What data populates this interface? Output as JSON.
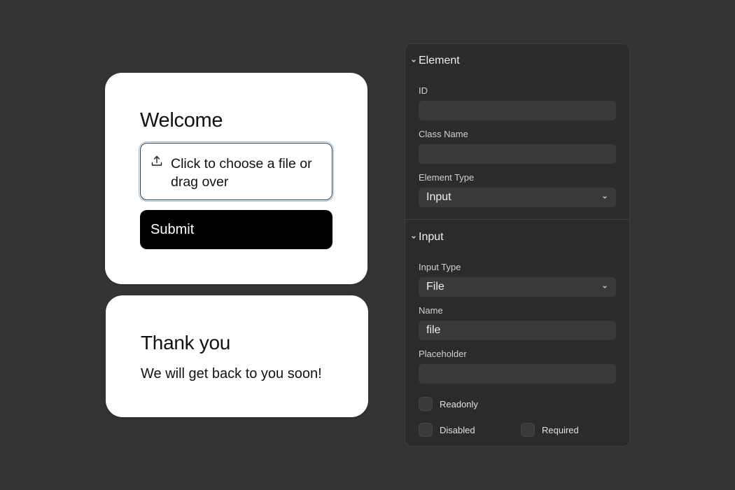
{
  "welcome_card": {
    "title": "Welcome",
    "file_input": {
      "placeholder": "Click to choose a file or drag over",
      "icon": "upload-icon"
    },
    "submit_label": "Submit"
  },
  "thanks_card": {
    "title": "Thank you",
    "message": "We will get back to you soon!"
  },
  "panel": {
    "element_section": {
      "title": "Element",
      "id_label": "ID",
      "id_value": "",
      "class_label": "Class Name",
      "class_value": "",
      "type_label": "Element Type",
      "type_value": "Input"
    },
    "input_section": {
      "title": "Input",
      "input_type_label": "Input Type",
      "input_type_value": "File",
      "name_label": "Name",
      "name_value": "file",
      "placeholder_label": "Placeholder",
      "placeholder_value": "",
      "readonly_label": "Readonly",
      "disabled_label": "Disabled",
      "required_label": "Required"
    }
  },
  "colors": {
    "background": "#333333",
    "panel": "#2b2b2b",
    "field": "#3a3a3a",
    "card": "#ffffff",
    "button": "#000000"
  }
}
